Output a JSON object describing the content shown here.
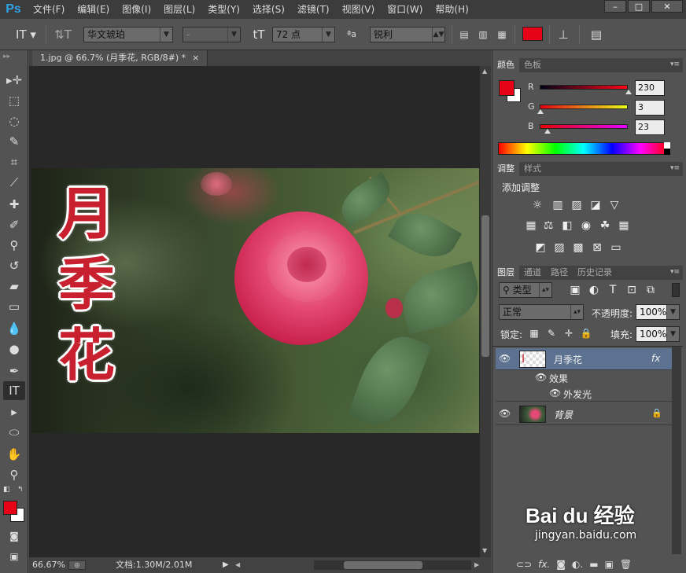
{
  "app": {
    "logo": "Ps",
    "menu": [
      "文件(F)",
      "编辑(E)",
      "图像(I)",
      "图层(L)",
      "类型(Y)",
      "选择(S)",
      "滤镜(T)",
      "视图(V)",
      "窗口(W)",
      "帮助(H)"
    ],
    "window_controls": [
      "–",
      "□",
      "✕"
    ]
  },
  "options": {
    "font_family": "华文琥珀",
    "font_style": "-",
    "size_icon": "tT",
    "font_size": "72 点",
    "aa_icon": "ªa",
    "antialias": "锐利",
    "text_color": "#e60317"
  },
  "document": {
    "tab_title": "1.jpg @ 66.7% (月季花, RGB/8#) *",
    "tab_close": "×",
    "text_layer": [
      "月",
      "季",
      "花"
    ]
  },
  "status": {
    "zoom": "66.67%",
    "doc_info": "文档:1.30M/2.01M"
  },
  "color_panel": {
    "tabs": [
      "颜色",
      "色板"
    ],
    "fg_color": "#e60317",
    "r_label": "R",
    "r_value": "230",
    "g_label": "G",
    "g_value": "3",
    "b_label": "B",
    "b_value": "23"
  },
  "adjust_panel": {
    "tabs": [
      "调整",
      "样式"
    ],
    "title": "添加调整"
  },
  "layers_panel": {
    "tabs": [
      "图层",
      "通道",
      "路径",
      "历史记录"
    ],
    "filter": "类型",
    "blend_mode": "正常",
    "opacity_label": "不透明度:",
    "opacity": "100%",
    "lock_label": "锁定:",
    "fill_label": "填充:",
    "fill": "100%",
    "layers": [
      {
        "name": "月季花",
        "fx": "fx"
      },
      {
        "name": "效果"
      },
      {
        "name": "外发光"
      },
      {
        "name": "背景"
      }
    ]
  },
  "watermark": {
    "brand": "Bai du 经验",
    "url": "jingyan.baidu.com"
  }
}
